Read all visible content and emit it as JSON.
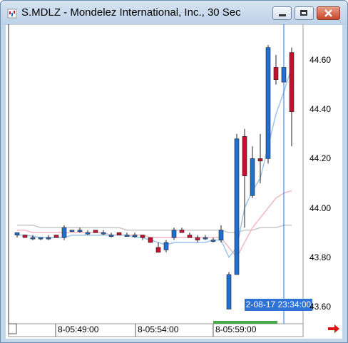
{
  "window": {
    "title": "S.MDLZ - Mondelez International, Inc., 30 Sec",
    "app_icon": "chart-app-icon",
    "buttons": [
      "minimize-icon",
      "restore-icon",
      "close-icon"
    ]
  },
  "chart_data": {
    "type": "candlestick",
    "title": "",
    "ylabels": [
      "44.60",
      "44.40",
      "44.20",
      "44.00",
      "43.80",
      "43.60"
    ],
    "xlabels": [
      "8-05:49:00",
      "8-05:54:00",
      "8-05:59:00"
    ],
    "crosshair_time": "2-08-17 23:34:00",
    "ylim": [
      43.55,
      44.75
    ],
    "colors": {
      "up": "#1f6fcf",
      "down": "#c8102e",
      "ma_fast": "#9ec4ea",
      "ma_mid": "#f4b8c6",
      "ma_slow": "#c8c8c8"
    },
    "candles": [
      {
        "o": 43.89,
        "h": 43.9,
        "l": 43.88,
        "c": 43.9
      },
      {
        "o": 43.89,
        "h": 43.89,
        "l": 43.88,
        "c": 43.88
      },
      {
        "o": 43.88,
        "h": 43.89,
        "l": 43.87,
        "c": 43.88
      },
      {
        "o": 43.88,
        "h": 43.88,
        "l": 43.87,
        "c": 43.88
      },
      {
        "o": 43.88,
        "h": 43.89,
        "l": 43.87,
        "c": 43.88
      },
      {
        "o": 43.89,
        "h": 43.89,
        "l": 43.88,
        "c": 43.88
      },
      {
        "o": 43.88,
        "h": 43.93,
        "l": 43.87,
        "c": 43.92
      },
      {
        "o": 43.91,
        "h": 43.91,
        "l": 43.91,
        "c": 43.91
      },
      {
        "o": 43.91,
        "h": 43.92,
        "l": 43.9,
        "c": 43.91
      },
      {
        "o": 43.9,
        "h": 43.91,
        "l": 43.89,
        "c": 43.9
      },
      {
        "o": 43.91,
        "h": 43.91,
        "l": 43.9,
        "c": 43.9
      },
      {
        "o": 43.9,
        "h": 43.91,
        "l": 43.89,
        "c": 43.9
      },
      {
        "o": 43.89,
        "h": 43.9,
        "l": 43.88,
        "c": 43.89
      },
      {
        "o": 43.9,
        "h": 43.9,
        "l": 43.89,
        "c": 43.89
      },
      {
        "o": 43.89,
        "h": 43.9,
        "l": 43.89,
        "c": 43.89
      },
      {
        "o": 43.89,
        "h": 43.9,
        "l": 43.88,
        "c": 43.89
      },
      {
        "o": 43.89,
        "h": 43.89,
        "l": 43.87,
        "c": 43.88
      },
      {
        "o": 43.88,
        "h": 43.88,
        "l": 43.86,
        "c": 43.86
      },
      {
        "o": 43.84,
        "h": 43.86,
        "l": 43.82,
        "c": 43.82
      },
      {
        "o": 43.83,
        "h": 43.87,
        "l": 43.82,
        "c": 43.86
      },
      {
        "o": 43.88,
        "h": 43.92,
        "l": 43.87,
        "c": 43.91
      },
      {
        "o": 43.91,
        "h": 43.92,
        "l": 43.9,
        "c": 43.9
      },
      {
        "o": 43.89,
        "h": 43.9,
        "l": 43.88,
        "c": 43.88
      },
      {
        "o": 43.88,
        "h": 43.89,
        "l": 43.86,
        "c": 43.87
      },
      {
        "o": 43.88,
        "h": 43.89,
        "l": 43.87,
        "c": 43.88
      },
      {
        "o": 43.87,
        "h": 43.88,
        "l": 43.86,
        "c": 43.87
      },
      {
        "o": 43.87,
        "h": 43.93,
        "l": 43.86,
        "c": 43.91
      },
      {
        "o": 43.59,
        "h": 43.74,
        "l": 43.59,
        "c": 43.73
      },
      {
        "o": 43.73,
        "h": 44.3,
        "l": 43.73,
        "c": 44.28
      },
      {
        "o": 44.29,
        "h": 44.32,
        "l": 43.92,
        "c": 44.13
      },
      {
        "o": 44.05,
        "h": 44.25,
        "l": 44.04,
        "c": 44.2
      },
      {
        "o": 44.2,
        "h": 44.3,
        "l": 44.1,
        "c": 44.19
      },
      {
        "o": 44.2,
        "h": 44.66,
        "l": 44.18,
        "c": 44.65
      },
      {
        "o": 44.57,
        "h": 44.62,
        "l": 44.5,
        "c": 44.52
      },
      {
        "o": 44.51,
        "h": 44.7,
        "l": 44.49,
        "c": 44.57
      },
      {
        "o": 44.63,
        "h": 44.65,
        "l": 44.25,
        "c": 44.39
      }
    ],
    "ma_fast": [
      43.89,
      43.89,
      43.885,
      43.88,
      43.88,
      43.88,
      43.88,
      43.89,
      43.89,
      43.89,
      43.89,
      43.89,
      43.89,
      43.89,
      43.89,
      43.88,
      43.88,
      43.87,
      43.86,
      43.85,
      43.86,
      43.86,
      43.86,
      43.86,
      43.86,
      43.87,
      43.87,
      43.8,
      43.84,
      44.0,
      44.07,
      44.12,
      44.25,
      44.38,
      44.47,
      44.57
    ],
    "ma_mid": [
      43.91,
      43.91,
      43.9,
      43.9,
      43.9,
      43.9,
      43.9,
      43.9,
      43.9,
      43.9,
      43.9,
      43.9,
      43.89,
      43.89,
      43.89,
      43.89,
      43.89,
      43.88,
      43.88,
      43.88,
      43.88,
      43.88,
      43.88,
      43.88,
      43.88,
      43.88,
      43.88,
      43.84,
      43.8,
      43.86,
      43.92,
      43.96,
      44.0,
      44.04,
      44.06,
      44.07
    ],
    "ma_slow": [
      43.93,
      43.93,
      43.93,
      43.92,
      43.92,
      43.92,
      43.92,
      43.92,
      43.92,
      43.92,
      43.92,
      43.92,
      43.92,
      43.92,
      43.91,
      43.91,
      43.91,
      43.91,
      43.91,
      43.91,
      43.91,
      43.91,
      43.91,
      43.91,
      43.91,
      43.91,
      43.91,
      43.9,
      43.9,
      43.91,
      43.91,
      43.92,
      43.92,
      43.92,
      43.93,
      43.93
    ]
  },
  "footer": {
    "scroll_right_icon": "red-arrow-right-icon"
  }
}
